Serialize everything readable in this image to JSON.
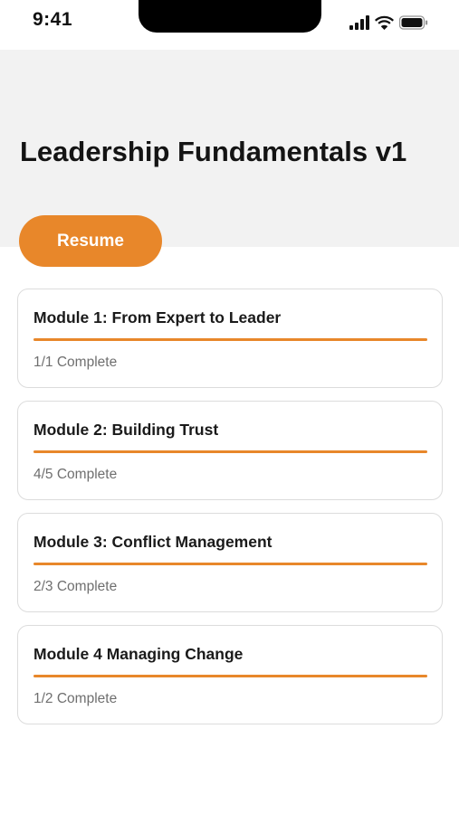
{
  "status_bar": {
    "time": "9:41",
    "icons": [
      "cellular-signal-icon",
      "wifi-icon",
      "battery-icon"
    ]
  },
  "course": {
    "title": "Leadership Fundamentals v1",
    "resume_label": "Resume"
  },
  "colors": {
    "accent": "#e8872a",
    "header_background": "#f2f2f2",
    "muted_text": "#6f6f6f"
  },
  "modules": [
    {
      "title": "Module 1: From Expert to Leader",
      "status": "1/1 Complete",
      "progress": 1.0
    },
    {
      "title": "Module 2: Building Trust",
      "status": "4/5 Complete",
      "progress": 1.0
    },
    {
      "title": "Module 3: Conflict Management",
      "status": "2/3 Complete",
      "progress": 1.0
    },
    {
      "title": "Module 4 Managing Change",
      "status": "1/2 Complete",
      "progress": 1.0
    }
  ]
}
